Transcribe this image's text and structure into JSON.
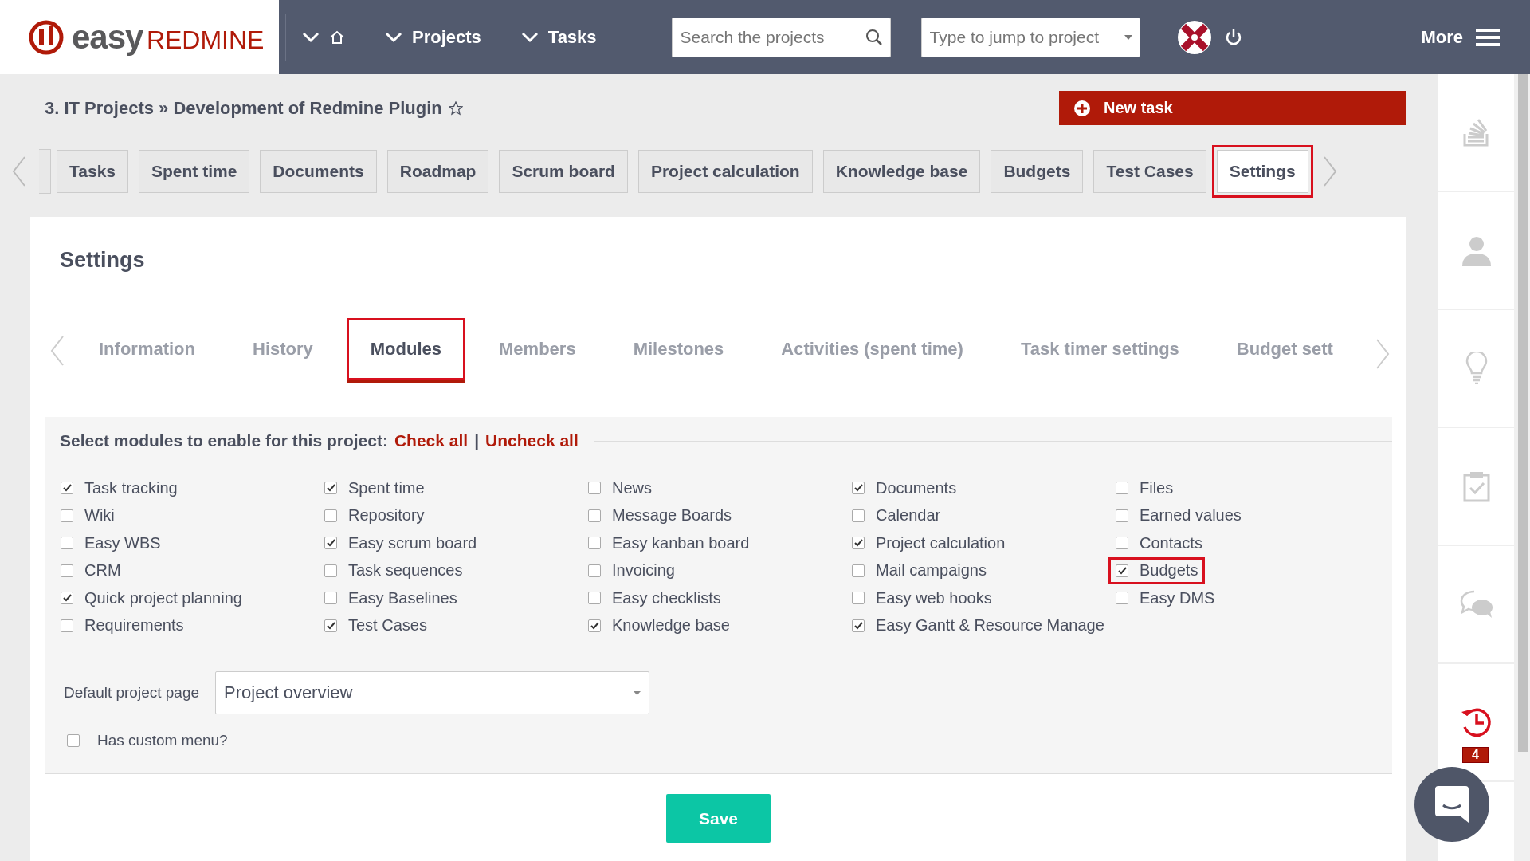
{
  "header": {
    "logo": {
      "word1": "easy",
      "word2": "REDMINE"
    },
    "nav": [
      {
        "label": "Projects"
      },
      {
        "label": "Tasks"
      }
    ],
    "search": {
      "placeholder": "Search the projects"
    },
    "jump": {
      "placeholder": "Type to jump to project"
    },
    "more": "More"
  },
  "breadcrumb": "3. IT Projects » Development of Redmine Plugin",
  "new_task": "New task",
  "menu_tabs": [
    {
      "label": "Tasks",
      "selected": false,
      "highlighted": false
    },
    {
      "label": "Spent time",
      "selected": false,
      "highlighted": false
    },
    {
      "label": "Documents",
      "selected": false,
      "highlighted": false
    },
    {
      "label": "Roadmap",
      "selected": false,
      "highlighted": false
    },
    {
      "label": "Scrum board",
      "selected": false,
      "highlighted": false
    },
    {
      "label": "Project calculation",
      "selected": false,
      "highlighted": false
    },
    {
      "label": "Knowledge base",
      "selected": false,
      "highlighted": false
    },
    {
      "label": "Budgets",
      "selected": false,
      "highlighted": false
    },
    {
      "label": "Test Cases",
      "selected": false,
      "highlighted": false
    },
    {
      "label": "Settings",
      "selected": true,
      "highlighted": true
    }
  ],
  "settings": {
    "title": "Settings",
    "tabs": [
      {
        "label": "Information",
        "selected": false,
        "highlighted": false
      },
      {
        "label": "History",
        "selected": false,
        "highlighted": false
      },
      {
        "label": "Modules",
        "selected": true,
        "highlighted": true
      },
      {
        "label": "Members",
        "selected": false,
        "highlighted": false
      },
      {
        "label": "Milestones",
        "selected": false,
        "highlighted": false
      },
      {
        "label": "Activities (spent time)",
        "selected": false,
        "highlighted": false
      },
      {
        "label": "Task timer settings",
        "selected": false,
        "highlighted": false
      },
      {
        "label": "Budget sett",
        "selected": false,
        "highlighted": false
      }
    ],
    "modules_heading": "Select modules to enable for this project:",
    "check_all": "Check all",
    "separator": "|",
    "uncheck_all": "Uncheck all",
    "modules": [
      {
        "label": "Task tracking",
        "checked": true,
        "highlighted": false
      },
      {
        "label": "Spent time",
        "checked": true,
        "highlighted": false
      },
      {
        "label": "News",
        "checked": false,
        "highlighted": false
      },
      {
        "label": "Documents",
        "checked": true,
        "highlighted": false
      },
      {
        "label": "Files",
        "checked": false,
        "highlighted": false
      },
      {
        "label": "Wiki",
        "checked": false,
        "highlighted": false
      },
      {
        "label": "Repository",
        "checked": false,
        "highlighted": false
      },
      {
        "label": "Message Boards",
        "checked": false,
        "highlighted": false
      },
      {
        "label": "Calendar",
        "checked": false,
        "highlighted": false
      },
      {
        "label": "Earned values",
        "checked": false,
        "highlighted": false
      },
      {
        "label": "Easy WBS",
        "checked": false,
        "highlighted": false
      },
      {
        "label": "Easy scrum board",
        "checked": true,
        "highlighted": false
      },
      {
        "label": "Easy kanban board",
        "checked": false,
        "highlighted": false
      },
      {
        "label": "Project calculation",
        "checked": true,
        "highlighted": false
      },
      {
        "label": "Contacts",
        "checked": false,
        "highlighted": false
      },
      {
        "label": "CRM",
        "checked": false,
        "highlighted": false
      },
      {
        "label": "Task sequences",
        "checked": false,
        "highlighted": false
      },
      {
        "label": "Invoicing",
        "checked": false,
        "highlighted": false
      },
      {
        "label": "Mail campaigns",
        "checked": false,
        "highlighted": false
      },
      {
        "label": "Budgets",
        "checked": true,
        "highlighted": true
      },
      {
        "label": "Quick project planning",
        "checked": true,
        "highlighted": false
      },
      {
        "label": "Easy Baselines",
        "checked": false,
        "highlighted": false
      },
      {
        "label": "Easy checklists",
        "checked": false,
        "highlighted": false
      },
      {
        "label": "Easy web hooks",
        "checked": false,
        "highlighted": false
      },
      {
        "label": "Easy DMS",
        "checked": false,
        "highlighted": false
      },
      {
        "label": "Requirements",
        "checked": false,
        "highlighted": false
      },
      {
        "label": "Test Cases",
        "checked": true,
        "highlighted": false
      },
      {
        "label": "Knowledge base",
        "checked": true,
        "highlighted": false
      },
      {
        "label": "Easy Gantt & Resource Manage",
        "checked": true,
        "highlighted": false
      }
    ],
    "default_page": {
      "label": "Default project page",
      "value": "Project overview"
    },
    "custom_menu": {
      "label": "Has custom menu?",
      "checked": false
    },
    "save": "Save"
  },
  "sidebar": {
    "badge": "4"
  }
}
